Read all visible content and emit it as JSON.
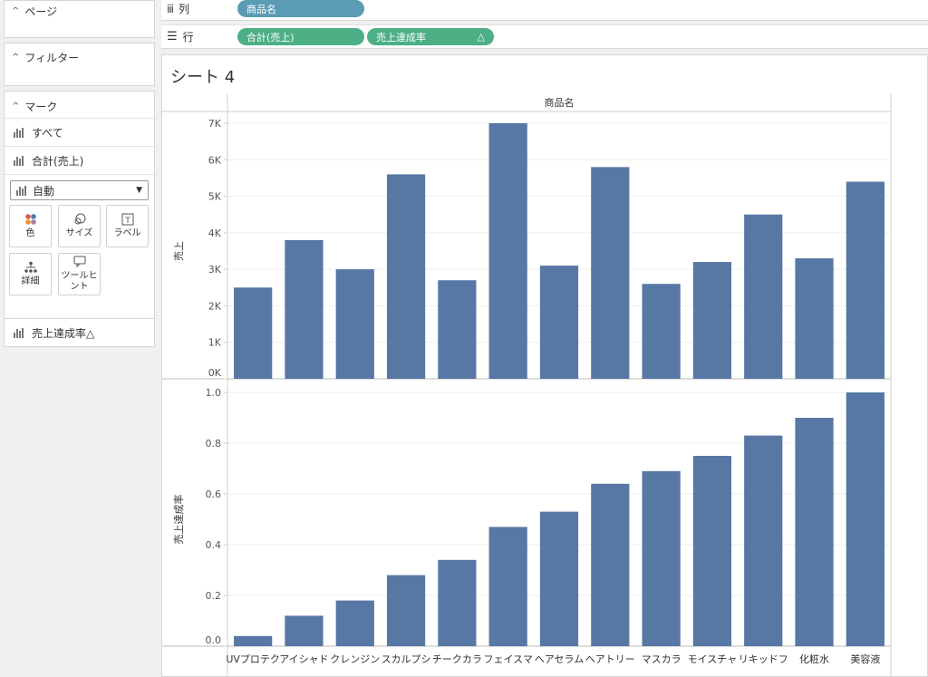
{
  "left_panel": {
    "pages": {
      "title": "ページ"
    },
    "filters": {
      "title": "フィルター"
    },
    "marks": {
      "title": "マーク",
      "rows": [
        {
          "label": "すべて"
        },
        {
          "label": "合計(売上)"
        }
      ],
      "mark_type": "自動",
      "buttons": {
        "color": "色",
        "size": "サイズ",
        "label": "ラベル",
        "detail": "詳細",
        "tooltip": "ツールヒ\nント"
      },
      "bottom_row": "売上達成率△"
    }
  },
  "shelves": {
    "columns": {
      "label": "列",
      "pills": [
        "商品名"
      ]
    },
    "rows": {
      "label": "行",
      "pills": [
        "合計(売上)",
        "売上達成率"
      ],
      "rate_pill_icon": "△"
    }
  },
  "sheet": {
    "title": "シート 4"
  },
  "colors": {
    "bar": "#5778a4",
    "pill_blue": "#5b9bb3",
    "pill_green": "#4caf85"
  },
  "chart_data": [
    {
      "type": "bar",
      "title": "商品名",
      "ylabel": "売上",
      "ylim": [
        0,
        7000
      ],
      "yticks": [
        "0K",
        "1K",
        "2K",
        "3K",
        "4K",
        "5K",
        "6K",
        "7K"
      ],
      "categories": [
        "UVプロテク",
        "アイシャド",
        "クレンジン",
        "スカルプシ",
        "チークカラ",
        "フェイスマ",
        "ヘアセラム",
        "ヘアトリー",
        "マスカラ",
        "モイスチャ",
        "リキッドフ",
        "化粧水",
        "美容液"
      ],
      "values": [
        2500,
        3800,
        3000,
        5600,
        2700,
        7000,
        3100,
        5800,
        2600,
        3200,
        4500,
        3300,
        5400
      ]
    },
    {
      "type": "bar",
      "ylabel": "売上達成率",
      "ylim": [
        0,
        1.0
      ],
      "yticks": [
        "0.0",
        "0.2",
        "0.4",
        "0.6",
        "0.8",
        "1.0"
      ],
      "categories": [
        "UVプロテク",
        "アイシャド",
        "クレンジン",
        "スカルプシ",
        "チークカラ",
        "フェイスマ",
        "ヘアセラム",
        "ヘアトリー",
        "マスカラ",
        "モイスチャ",
        "リキッドフ",
        "化粧水",
        "美容液"
      ],
      "values": [
        0.04,
        0.12,
        0.18,
        0.28,
        0.34,
        0.47,
        0.53,
        0.64,
        0.69,
        0.75,
        0.83,
        0.9,
        1.0
      ]
    }
  ]
}
